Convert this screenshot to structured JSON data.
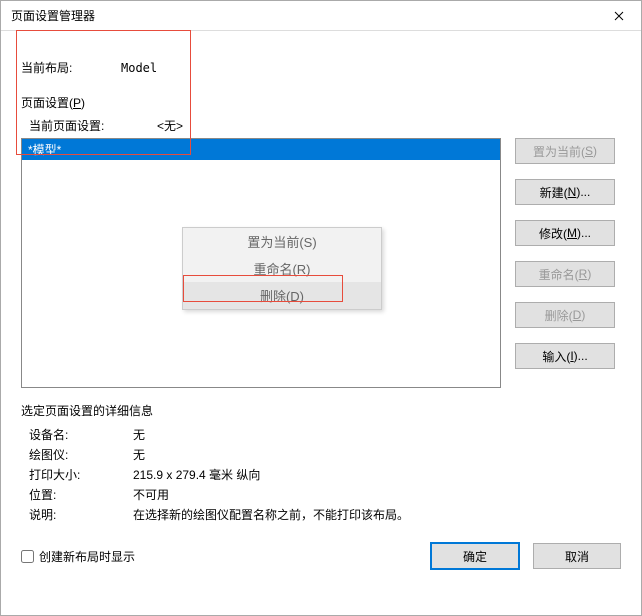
{
  "title": "页面设置管理器",
  "layout": {
    "label": "当前布局:",
    "value": "Model"
  },
  "pagesetup": {
    "group_label": "页面设置(P)",
    "current_label": "当前页面设置:",
    "current_value": "<无>",
    "list": {
      "selected": "*模型*"
    }
  },
  "context_menu": {
    "set_current": "置为当前(S)",
    "rename": "重命名(R)",
    "delete": "删除(D)"
  },
  "buttons": {
    "set_current": "置为当前(S)",
    "new": "新建(N)...",
    "modify": "修改(M)...",
    "rename": "重命名(R)",
    "delete": "删除(D)",
    "import": "输入(I)..."
  },
  "details": {
    "title": "选定页面设置的详细信息",
    "device_label": "设备名:",
    "device_value": "无",
    "plotter_label": "绘图仪:",
    "plotter_value": "无",
    "size_label": "打印大小:",
    "size_value": "215.9 x 279.4 毫米  纵向",
    "location_label": "位置:",
    "location_value": "不可用",
    "desc_label": "说明:",
    "desc_value": "在选择新的绘图仪配置名称之前，不能打印该布局。"
  },
  "bottom": {
    "checkbox_label": "创建新布局时显示",
    "ok": "确定",
    "cancel": "取消"
  }
}
